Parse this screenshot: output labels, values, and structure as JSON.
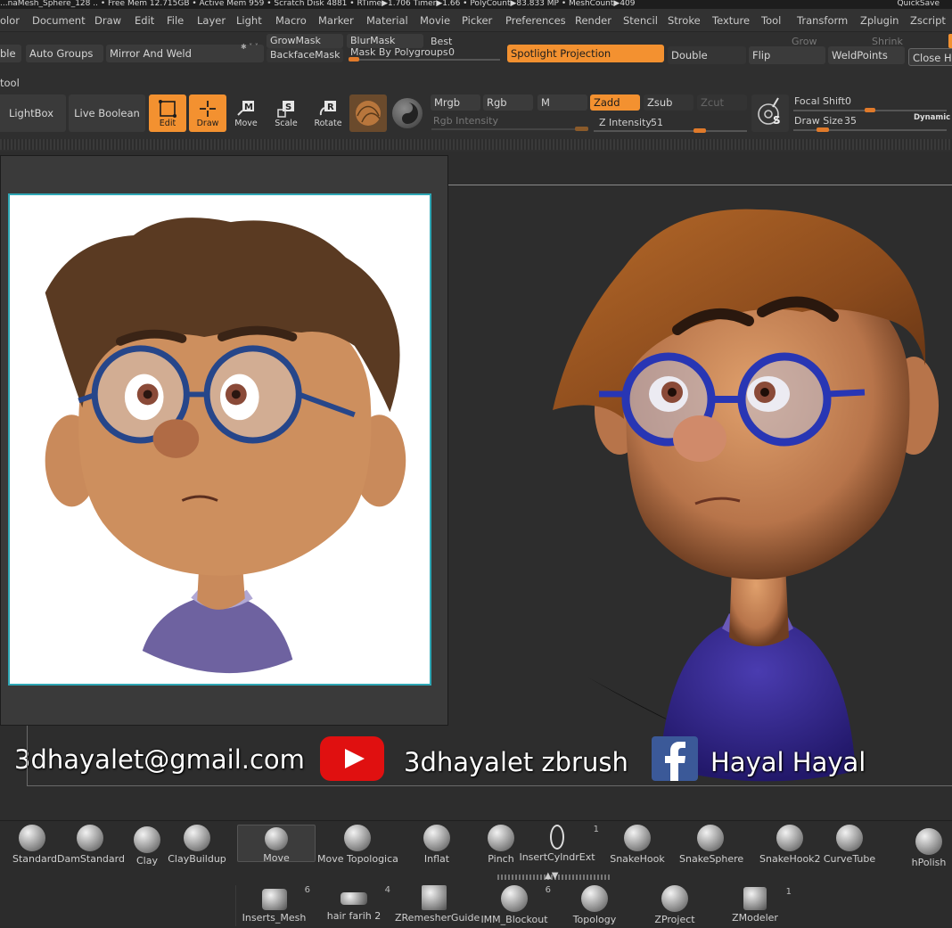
{
  "statusbar": {
    "text": "...naMesh_Sphere_128 .. • Free Mem 12.715GB • Active Mem 959 • Scratch Disk 4881 • RTime▶1.706 Timer▶1.66 • PolyCount▶83.833 MP • MeshCount▶409",
    "quicksave": "QuickSave"
  },
  "menu": [
    "olor",
    "Document",
    "Draw",
    "Edit",
    "File",
    "Layer",
    "Light",
    "Macro",
    "Marker",
    "Material",
    "Movie",
    "Picker",
    "Preferences",
    "Render",
    "Stencil",
    "Stroke",
    "Texture",
    "Tool",
    "Transform",
    "Zplugin",
    "Zscript"
  ],
  "toolbar1": {
    "ble": "ble",
    "auto_groups": "Auto Groups",
    "mirror_weld": "Mirror And Weld",
    "grow_mask": "GrowMask",
    "backface_mask": "BackfaceMask",
    "blur_mask": "BlurMask",
    "best": "Best",
    "mask_by_polygroups": "Mask By Polygroups",
    "mask_by_polygroups_value": "0",
    "mask_by_polygroups_level": 0.05,
    "spotlight_projection": "Spotlight Projection",
    "double": "Double",
    "flip": "Flip",
    "weld_points": "WeldPoints",
    "close_holes": "Close Ho",
    "grow": "Grow",
    "shrink": "Shrink"
  },
  "toolbar2": {
    "tool_label": "tool",
    "lightbox": "LightBox",
    "live_boolean": "Live Boolean",
    "edit": "Edit",
    "draw": "Draw",
    "move": "Move",
    "scale": "Scale",
    "rotate": "Rotate",
    "mrgb": "Mrgb",
    "rgb": "Rgb",
    "m": "M",
    "zadd": "Zadd",
    "zsub": "Zsub",
    "zcut": "Zcut",
    "rgb_intensity": "Rgb Intensity",
    "z_intensity_label": "Z Intensity",
    "z_intensity_value": "51",
    "focal_shift_label": "Focal Shift",
    "focal_shift_value": "0",
    "draw_size_label": "Draw Size",
    "draw_size_value": "35",
    "dynamic": "Dynamic"
  },
  "overlay": {
    "email": "3dhayalet@gmail.com",
    "youtube": "3dhayalet zbrush",
    "facebook": "Hayal Hayal"
  },
  "brushes": [
    {
      "label": "Standard"
    },
    {
      "label": "DamStandard"
    },
    {
      "label": "Clay"
    },
    {
      "label": "ClayBuildup"
    },
    {
      "label": "Move"
    },
    {
      "label": "Move Topologica"
    },
    {
      "label": "Inflat"
    },
    {
      "label": "Pinch"
    },
    {
      "label": "InsertCylndrExt",
      "count": "1"
    },
    {
      "label": "SnakeHook"
    },
    {
      "label": "SnakeSphere"
    },
    {
      "label": "SnakeHook2"
    },
    {
      "label": "CurveTube"
    },
    {
      "label": "hPolish"
    }
  ],
  "brushes2": [
    {
      "label": "Inserts_Mesh",
      "count": "6"
    },
    {
      "label": "hair farih 2",
      "count": "4"
    },
    {
      "label": "ZRemesherGuide"
    },
    {
      "label": "IMM_Blockout",
      "count": "6"
    },
    {
      "label": "Topology"
    },
    {
      "label": "ZProject"
    },
    {
      "label": "ZModeler",
      "count": "1"
    }
  ],
  "colors": {
    "accent": "#f39130",
    "ref_border": "#2fa7b5",
    "youtube": "#e01010",
    "facebook": "#3b5998"
  }
}
